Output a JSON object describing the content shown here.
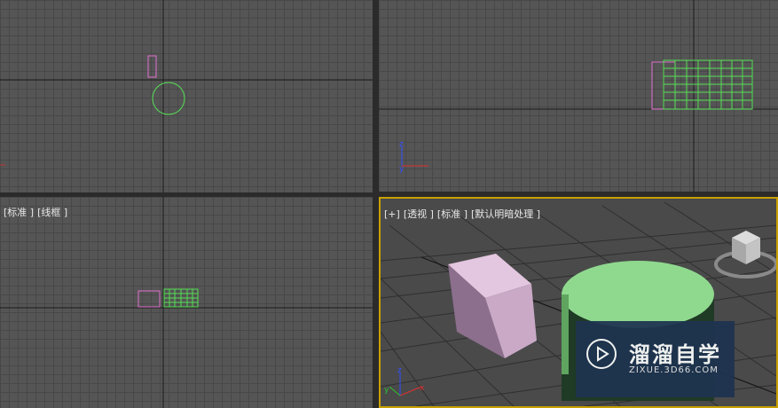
{
  "viewports": {
    "top": {
      "label_parts": []
    },
    "front": {
      "label_parts": []
    },
    "left": {
      "label_parts": [
        "[标准 ]",
        "[线框 ]"
      ]
    },
    "perspective": {
      "label_parts": [
        "[+]",
        "[透视 ]",
        "[标准 ]",
        "[默认明暗处理 ]"
      ]
    }
  },
  "axes": {
    "z": "z",
    "y": "y",
    "x": "x"
  },
  "colors": {
    "grid_bg": "#555555",
    "grid_line": "#484848",
    "wire_green": "#55e055",
    "wire_pink": "#e070d0",
    "box_pink": "#d9b3d4",
    "cylinder_green": "#8fd98f",
    "active_border": "#c8a000"
  },
  "icons": {
    "viewcube": "viewcube-icon",
    "logo_play": "play-circle-icon"
  },
  "watermark": {
    "title": "溜溜自学",
    "subtitle": "ZIXUE.3D66.COM"
  }
}
